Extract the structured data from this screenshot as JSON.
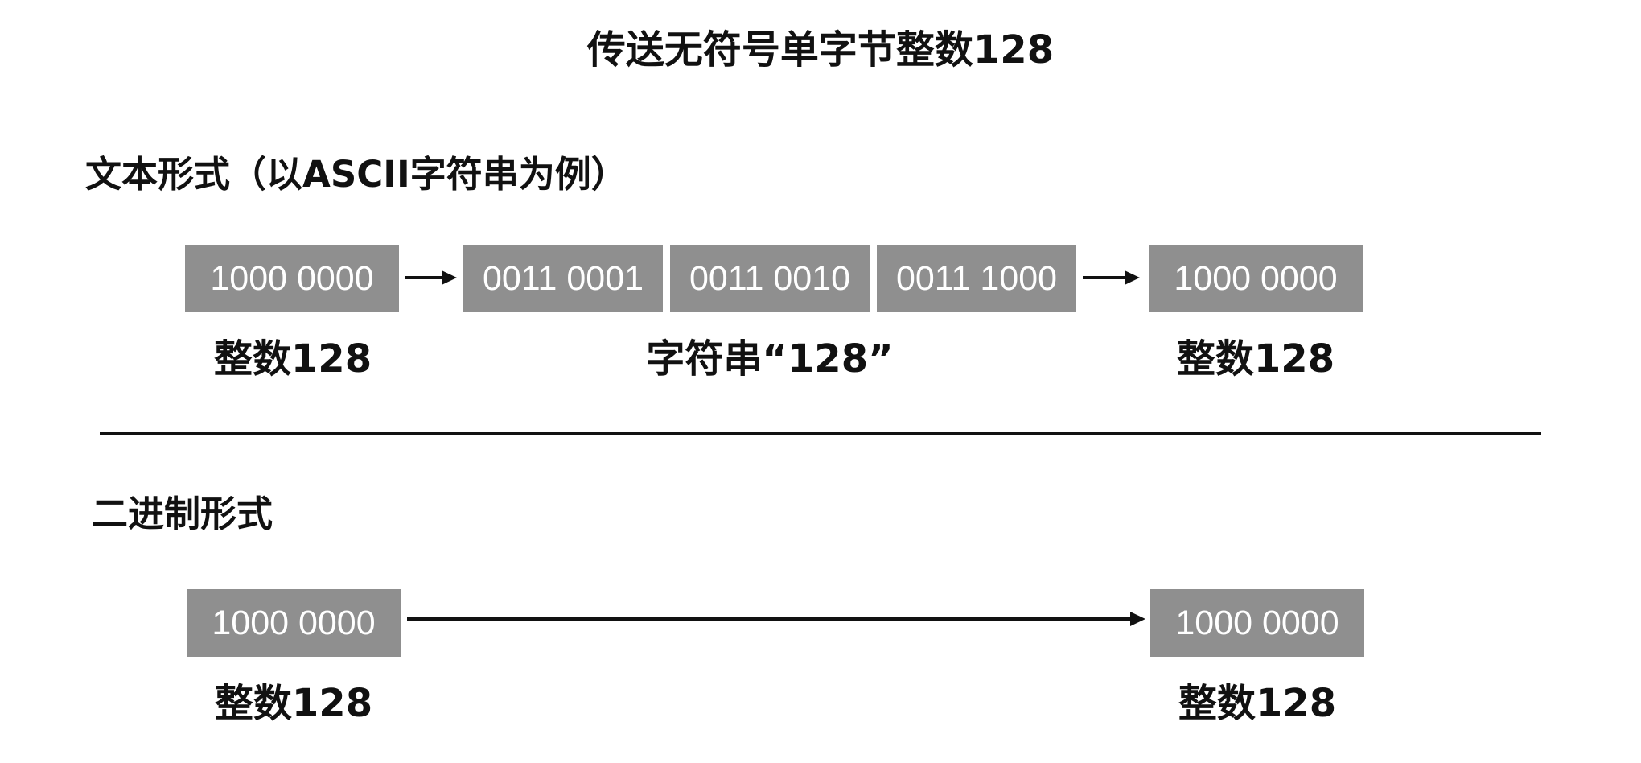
{
  "title": "传送无符号单字节整数128",
  "text_section": {
    "heading": "文本形式（以ASCII字符串为例）",
    "source_byte": "1000 0000",
    "string_bytes": [
      "0011 0001",
      "0011 0010",
      "0011 1000"
    ],
    "result_byte": "1000 0000",
    "source_label": "整数128",
    "string_label": "字符串“128”",
    "result_label": "整数128"
  },
  "binary_section": {
    "heading": "二进制形式",
    "source_byte": "1000 0000",
    "result_byte": "1000 0000",
    "source_label": "整数128",
    "result_label": "整数128"
  }
}
